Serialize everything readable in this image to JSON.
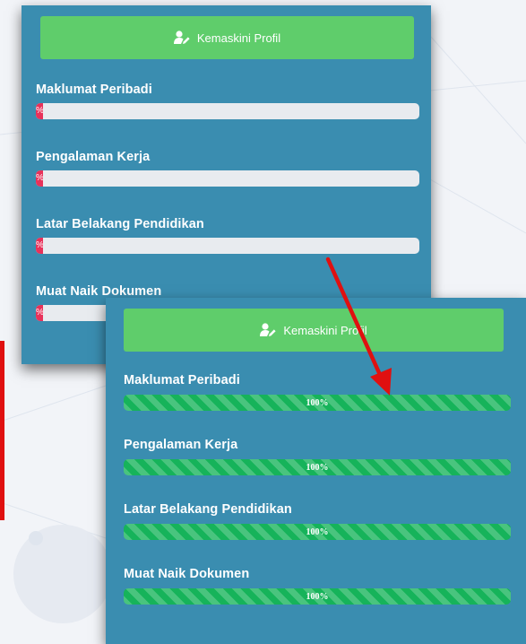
{
  "before_panel": {
    "update_profile_button": "Kemaskini Profil",
    "sections": [
      {
        "label": "Maklumat Peribadi",
        "progress_text": "%",
        "progress": 0
      },
      {
        "label": "Pengalaman Kerja",
        "progress_text": "%",
        "progress": 0
      },
      {
        "label": "Latar Belakang Pendidikan",
        "progress_text": "%",
        "progress": 0
      },
      {
        "label": "Muat Naik Dokumen",
        "progress_text": "%",
        "progress": 0
      }
    ]
  },
  "after_panel": {
    "update_profile_button": "Kemaskini Profil",
    "sections": [
      {
        "label": "Maklumat Peribadi",
        "progress_text": "100%",
        "progress": 1.0
      },
      {
        "label": "Pengalaman Kerja",
        "progress_text": "100%",
        "progress": 1.0
      },
      {
        "label": "Latar Belakang Pendidikan",
        "progress_text": "100%",
        "progress": 1.0
      },
      {
        "label": "Muat Naik Dokumen",
        "progress_text": "100%",
        "progress": 1.0
      }
    ]
  },
  "colors": {
    "panel_bg": "#3a8db0",
    "button_green": "#5fcd6b",
    "bar_empty": "#e8ebef",
    "bar_zero_segment": "#e8325a",
    "bar_full": "#16b35a",
    "arrow": "#e01010"
  },
  "icons": {
    "button_icon": "user-edit-icon"
  }
}
